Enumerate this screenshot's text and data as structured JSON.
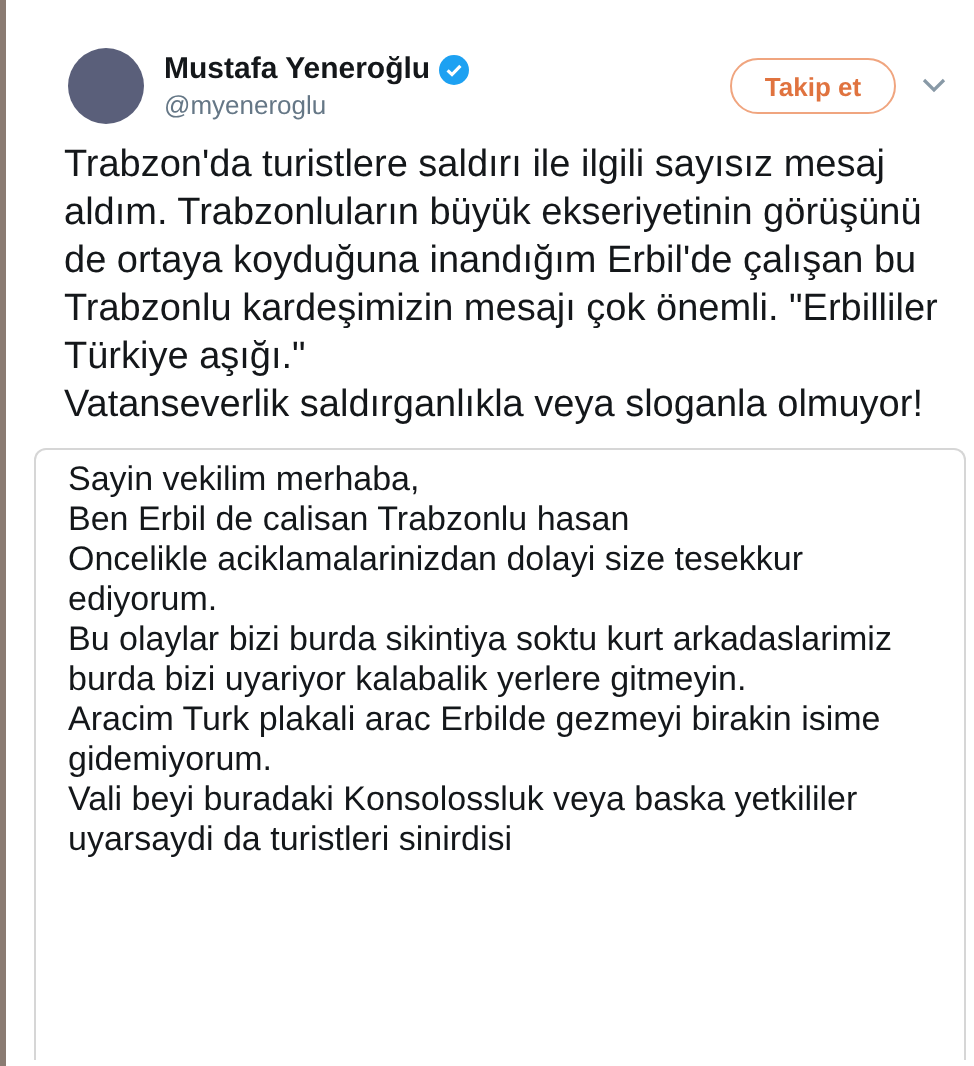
{
  "author": {
    "name": "Mustafa Yeneroğlu",
    "verified": true,
    "handle": "@myeneroglu"
  },
  "follow_button": {
    "label": "Takip et"
  },
  "tweet_text": [
    "Trabzon'da turistlere saldırı ile ilgili sayısız mesaj aldım. Trabzonluların büyük ekseriyetinin görüşünü de ortaya koyduğuna inandığım Erbil'de çalışan bu Trabzonlu kardeşimizin mesajı çok önemli. \"Erbilliler Türkiye aşığı.\"",
    "Vatanseverlik saldırganlıkla veya sloganla olmuyor!"
  ],
  "attached_message": [
    "Sayin vekilim merhaba,",
    "Ben Erbil de calisan Trabzonlu hasan",
    "Oncelikle aciklamalarinizdan dolayi size tesekkur ediyorum.",
    "Bu olaylar bizi burda sikintiya soktu kurt arkadaslarimiz burda bizi uyariyor kalabalik yerlere gitmeyin.",
    "Aracim Turk plakali arac Erbilde gezmeyi birakin isime gidemiyorum.",
    "Vali beyi buradaki Konsolossluk veya baska yetkililer uyarsaydi da turistleri sinirdisi"
  ]
}
